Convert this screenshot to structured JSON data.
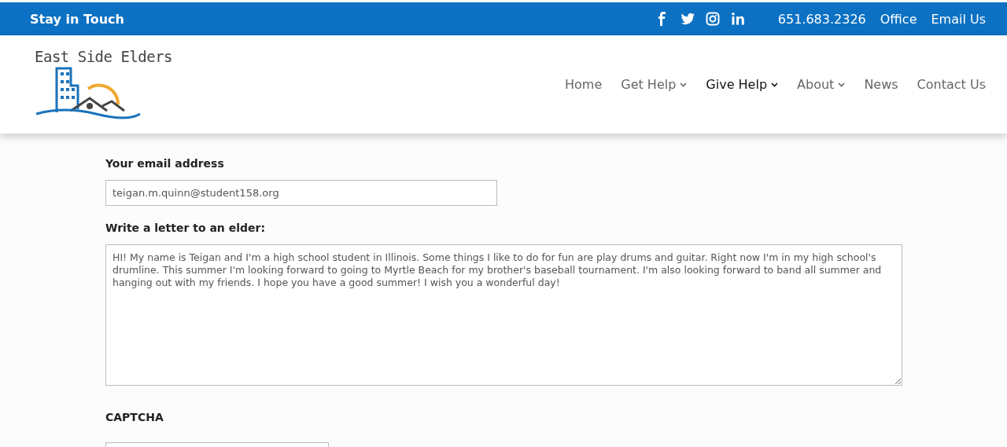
{
  "top_bar": {
    "title": "Stay in Touch",
    "social": [
      {
        "kind": "facebook"
      },
      {
        "kind": "twitter"
      },
      {
        "kind": "instagram"
      },
      {
        "kind": "linkedin"
      }
    ],
    "links": [
      "651.683.2326",
      "Office",
      "Email Us"
    ]
  },
  "header": {
    "logo_text": "East Side Elders",
    "nav": [
      {
        "label": "Home",
        "selected": false,
        "dropdown": false
      },
      {
        "label": "Get Help",
        "selected": false,
        "dropdown": true
      },
      {
        "label": "Give Help",
        "selected": true,
        "dropdown": true
      },
      {
        "label": "About",
        "selected": false,
        "dropdown": true
      },
      {
        "label": "News",
        "selected": false,
        "dropdown": false
      },
      {
        "label": "Contact Us",
        "selected": false,
        "dropdown": false
      }
    ]
  },
  "form": {
    "email_label": "Your email address",
    "email_value": "teigan.m.quinn@student158.org",
    "letter_label": "Write a letter to an elder:",
    "letter_value": "HI! My name is Teigan and I'm a high school student in Illinois. Some things I like to do for fun are play drums and guitar. Right now I'm in my high school's drumline. This summer I'm looking forward to going to Myrtle Beach for my brother's baseball tournament. I'm also looking forward to band all summer and hanging out with my friends. I hope you have a good summer! I wish you a wonderful day!",
    "captcha_label": "CAPTCHA"
  }
}
